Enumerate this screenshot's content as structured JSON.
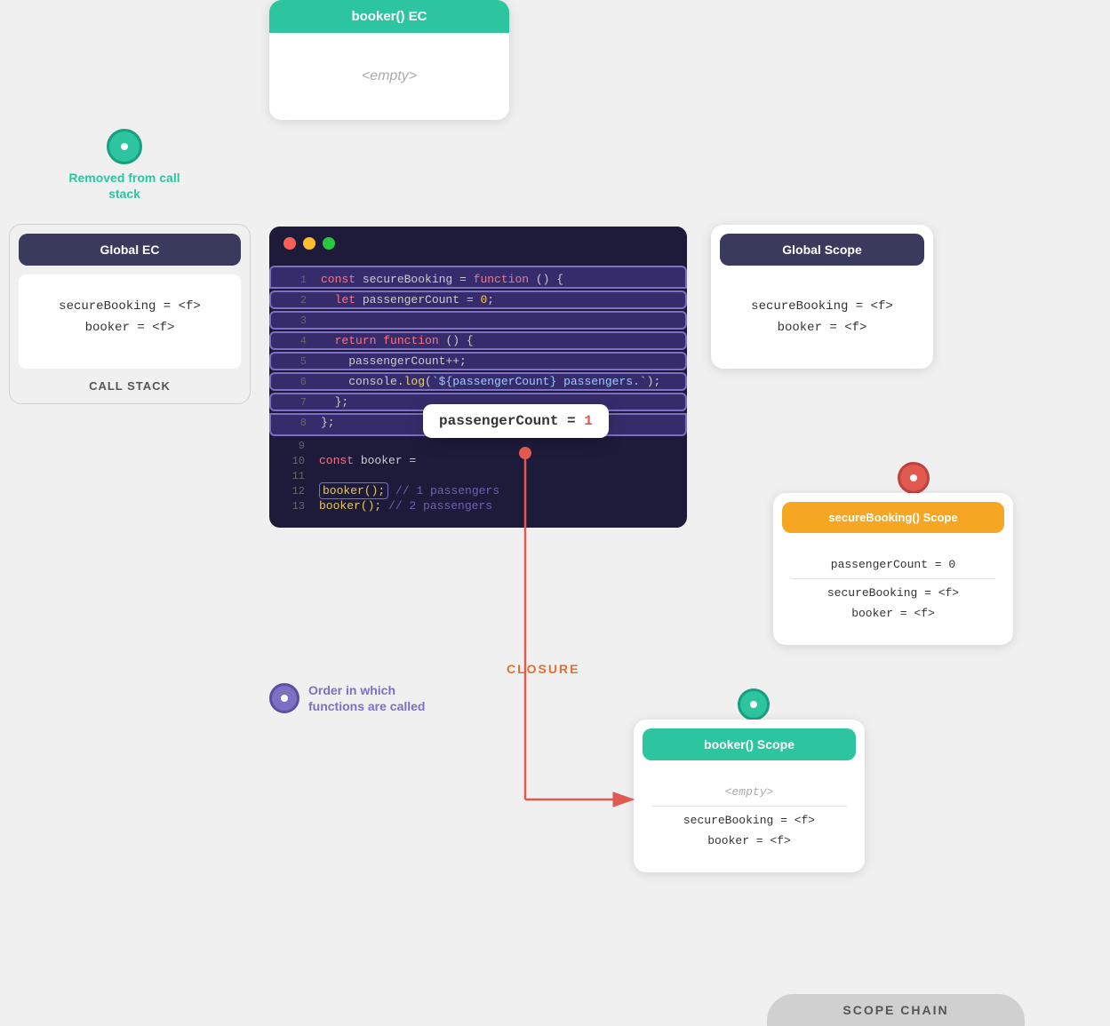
{
  "bookerEC": {
    "title": "booker() EC",
    "body": "<empty>"
  },
  "removedFromCallStack": {
    "text": "Removed from call stack"
  },
  "globalEC": {
    "title": "Global EC",
    "line1": "secureBooking = <f>",
    "line2": "booker = <f>",
    "callStackLabel": "CALL STACK"
  },
  "globalScope": {
    "title": "Global Scope",
    "line1": "secureBooking = <f>",
    "line2": "booker = <f>"
  },
  "secureBookingScope": {
    "title": "secureBooking() Scope",
    "line1": "passengerCount = 0",
    "line2": "secureBooking = <f>",
    "line3": "booker = <f>"
  },
  "bookerScope": {
    "title": "booker() Scope",
    "emptyLine": "<empty>",
    "line1": "secureBooking = <f>",
    "line2": "booker = <f>"
  },
  "scopeChain": {
    "label": "SCOPE CHAIN"
  },
  "passengerTooltip": {
    "text": "passengerCount = ",
    "value": "1"
  },
  "closureLabel": "CLOSURE",
  "orderText": "Order in which\nfunctions are called",
  "code": {
    "lines": [
      {
        "num": "1",
        "content": "const secureBooking = function () {"
      },
      {
        "num": "2",
        "content": "  let passengerCount = 0;"
      },
      {
        "num": "3",
        "content": ""
      },
      {
        "num": "4",
        "content": "  return function () {"
      },
      {
        "num": "5",
        "content": "    passengerCount++;"
      },
      {
        "num": "6",
        "content": "    console.log(`${passengerCount} passengers.`);"
      },
      {
        "num": "7",
        "content": "  };"
      },
      {
        "num": "8",
        "content": "};"
      },
      {
        "num": "9",
        "content": ""
      },
      {
        "num": "10",
        "content": "const booker = "
      },
      {
        "num": "11",
        "content": ""
      },
      {
        "num": "12",
        "content": "booker(); // 1 passengers"
      },
      {
        "num": "13",
        "content": "booker(); // 2 passengers"
      }
    ]
  }
}
